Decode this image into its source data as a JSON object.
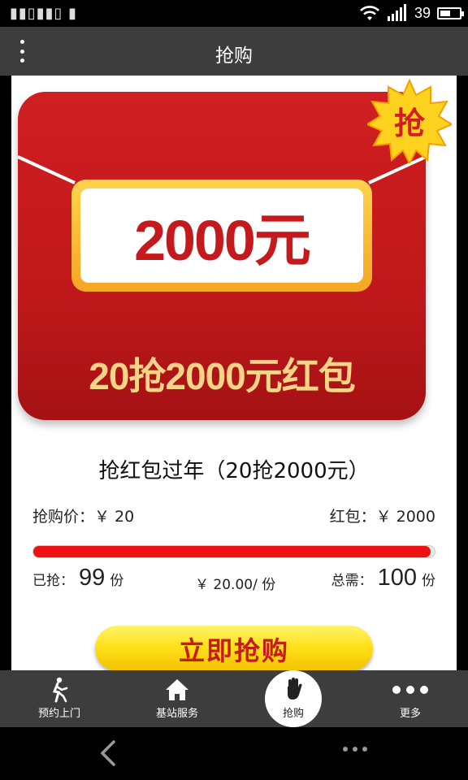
{
  "status_bar": {
    "battery_level": "39",
    "signal_icon": "signal-bars-icon",
    "wifi_icon": "wifi-icon"
  },
  "app_bar": {
    "title": "抢购",
    "menu_icon": "more-vertical-icon"
  },
  "envelope": {
    "badge": "抢",
    "amount": "2000元",
    "slogan": "20抢2000元红包"
  },
  "product": {
    "title": "抢红包过年（20抢2000元）",
    "price_label": "抢购价：",
    "price_value": "￥ 20",
    "reward_label": "红包：",
    "reward_value": "￥ 2000",
    "progress_fraction": 0.99,
    "grabbed_label": "已抢：",
    "grabbed_count": "99",
    "grabbed_unit": "份",
    "unit_price": "￥ 20.00/ 份",
    "total_label": "总需：",
    "total_count": "100",
    "total_unit": "份",
    "buy_button": "立即抢购"
  },
  "bottom_nav": {
    "items": [
      {
        "label": "预约上门",
        "icon": "running-person-icon"
      },
      {
        "label": "基站服务",
        "icon": "home-icon"
      },
      {
        "label": "抢购",
        "icon": "hand-icon"
      },
      {
        "label": "更多",
        "icon": "more-horizontal-icon"
      }
    ],
    "active_index": 2
  }
}
